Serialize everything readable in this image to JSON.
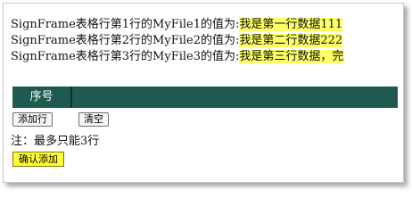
{
  "lines": [
    {
      "prefix": "SignFrame表格行第1行的MyFile1的值为:",
      "value": "我是第一行数据111"
    },
    {
      "prefix": "SignFrame表格行第2行的MyFile2的值为:",
      "value": "我是第二行数据222"
    },
    {
      "prefix": "SignFrame表格行第3行的MyFile3的值为:",
      "value": "我是第三行数据，完"
    }
  ],
  "table": {
    "seq_header": "序号"
  },
  "buttons": {
    "add_row": "添加行",
    "clear": "清空",
    "confirm_add": "确认添加"
  },
  "note": "注：最多只能3行",
  "colors": {
    "highlight": "#ffff66",
    "header_bg": "#1f5a50",
    "confirm_bg": "#ffff33"
  }
}
